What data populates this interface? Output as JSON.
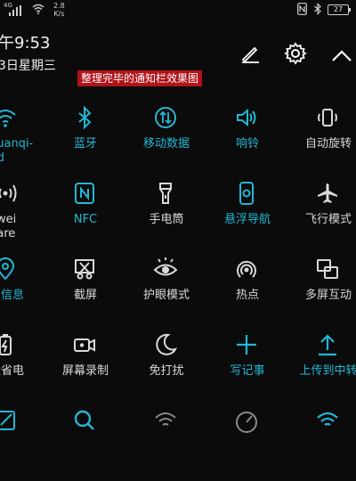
{
  "status_bar": {
    "network": "4G",
    "speed_value": "2.8",
    "speed_unit": "K/s",
    "battery": "27"
  },
  "header": {
    "time": "午9:53",
    "date": "3日星期三"
  },
  "annotation": "整理完毕的通知栏效果图",
  "tiles": {
    "wlan_label_1": "huanqi-",
    "wlan_label_2": "ltd",
    "bluetooth": "蓝牙",
    "mobile_data": "移动数据",
    "ringer": "响铃",
    "auto_rotate": "自动旋转",
    "huawei_share_1": "awei",
    "huawei_share_2": "hare",
    "nfc": "NFC",
    "flashlight": "手电筒",
    "floating_nav": "悬浮导航",
    "airplane": "飞行模式",
    "location": "置信息",
    "screenshot": "截屏",
    "eye_comfort": "护眼模式",
    "hotspot": "热点",
    "multi_screen": "多屏互动",
    "power_saving": "设省电",
    "screen_record": "屏幕录制",
    "do_not_disturb": "免打扰",
    "write_note": "写记事",
    "upload": "上传到中转"
  },
  "colors": {
    "accent": "#23b7d3",
    "inactive": "#d9d9d9",
    "background": "#0b0b0c",
    "banner": "#b01318"
  }
}
